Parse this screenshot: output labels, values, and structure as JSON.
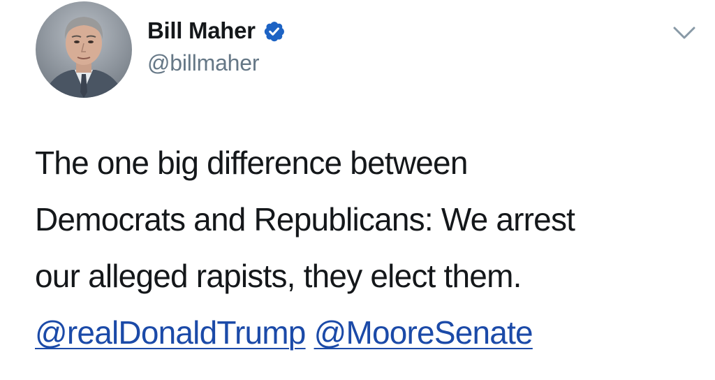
{
  "tweet": {
    "author": {
      "display_name": "Bill Maher",
      "handle": "@billmaher",
      "verified": true,
      "avatar_icon": "profile-photo"
    },
    "menu_icon": "chevron-down-icon",
    "text_lines": [
      "The one big difference between",
      "Democrats and Republicans: We arrest",
      "our alleged rapists, they elect them."
    ],
    "mentions": [
      "@realDonaldTrump",
      "@MooreSenate"
    ]
  },
  "colors": {
    "text": "#14171a",
    "secondary": "#657786",
    "link": "#1b4aa8",
    "verified_badge": "#1d63c4",
    "background": "#ffffff"
  }
}
